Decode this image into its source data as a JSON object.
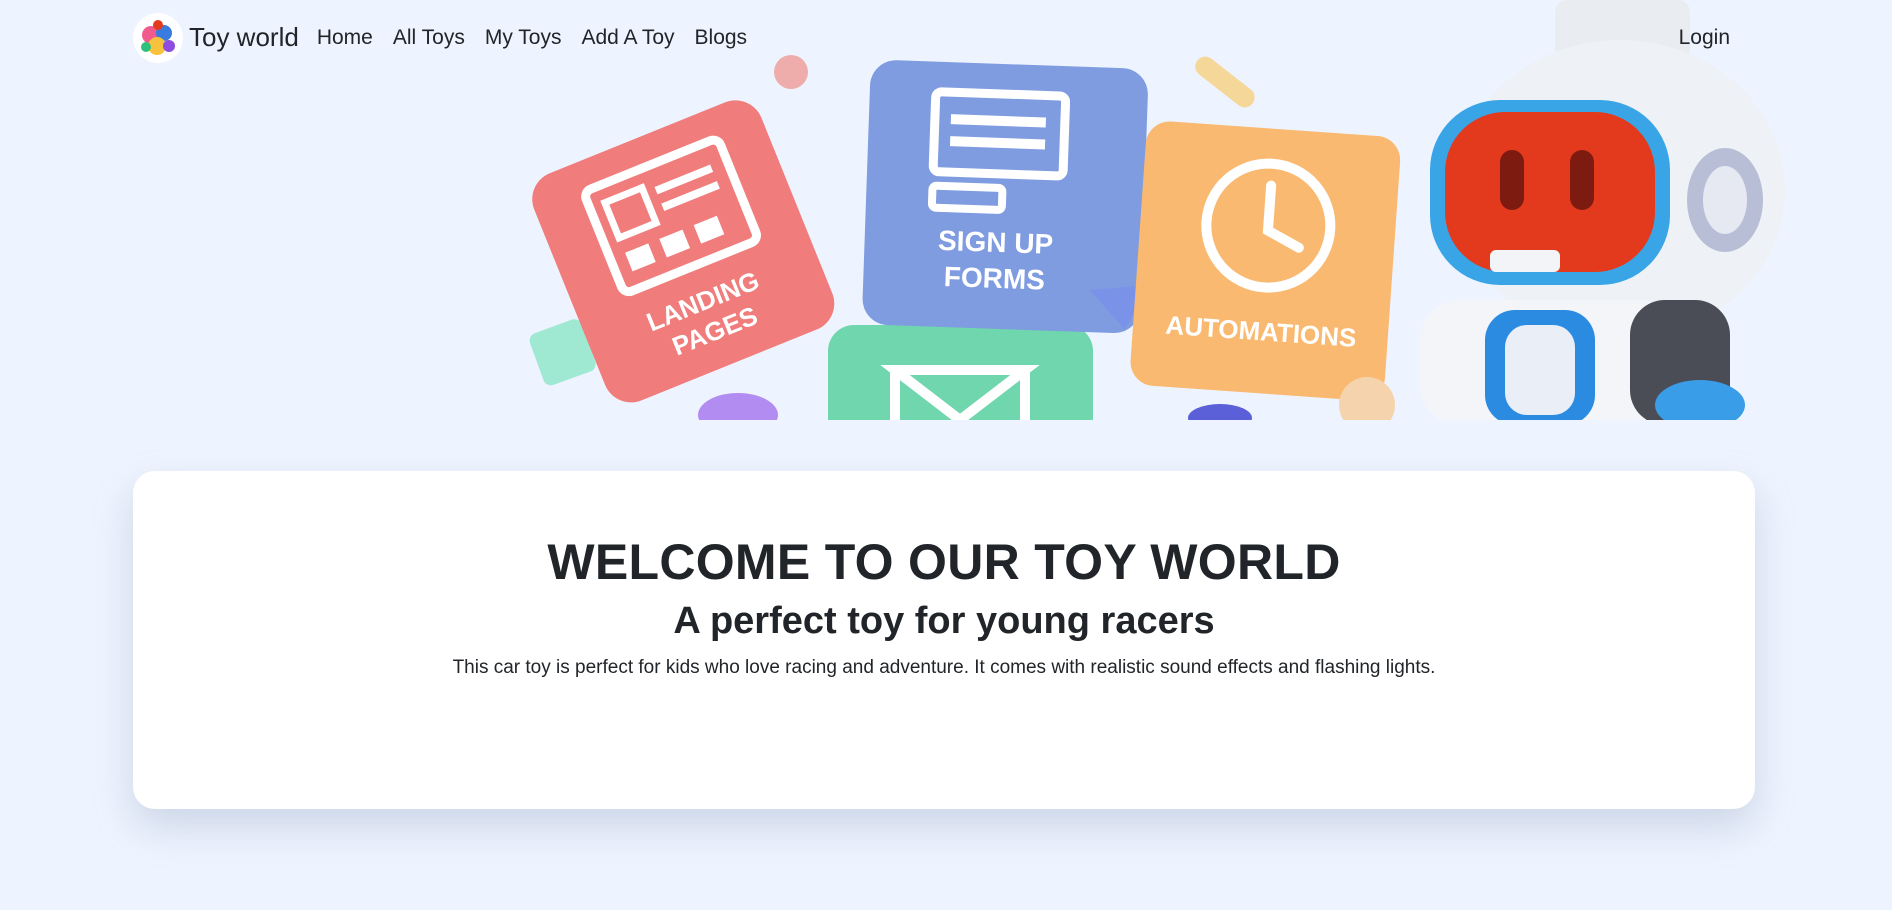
{
  "navbar": {
    "brand": "Toy world",
    "links": [
      "Home",
      "All Toys",
      "My Toys",
      "Add A Toy",
      "Blogs"
    ],
    "login": "Login"
  },
  "hero": {
    "tiles": {
      "landing": "LANDING PAGES",
      "signup": "SIGN UP FORMS",
      "automations": "AUTOMATIONS"
    }
  },
  "welcome": {
    "title": "WELCOME TO OUR TOY WORLD",
    "subtitle": "A perfect toy for young racers",
    "description": "This car toy is perfect for kids who love racing and adventure. It comes with realistic sound effects and flashing lights."
  },
  "colors": {
    "background": "#eef4ff",
    "card": "#ffffff",
    "text": "#212529",
    "tile_red": "#f07c7c",
    "tile_blue": "#7f9ce0",
    "tile_orange": "#f9b970",
    "tile_green": "#6fd6ae"
  }
}
